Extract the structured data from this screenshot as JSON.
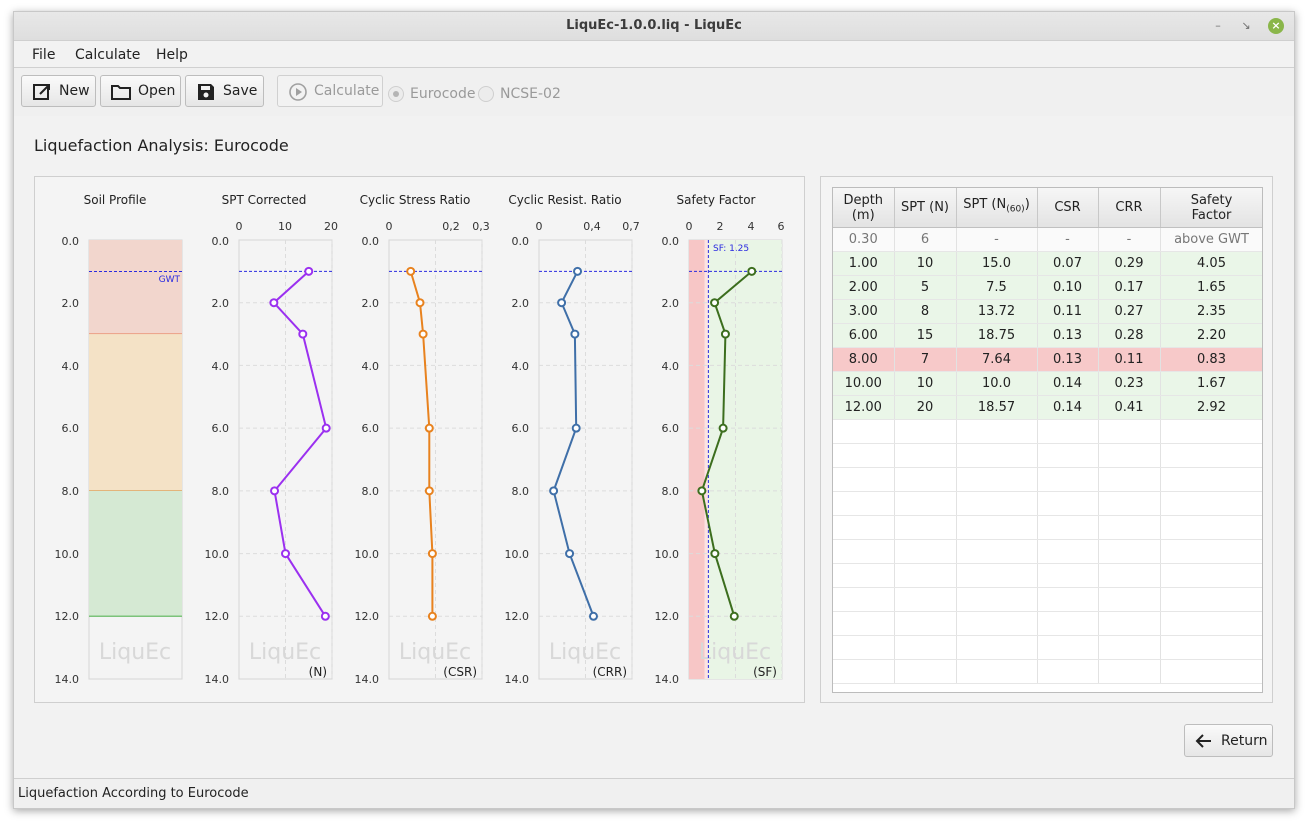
{
  "window": {
    "title": "LiquEc-1.0.0.liq - LiquEc"
  },
  "menu": [
    "File",
    "Calculate",
    "Help"
  ],
  "toolbar": {
    "new_label": "New",
    "open_label": "Open",
    "save_label": "Save",
    "calculate_label": "Calculate",
    "eurocode_label": "Eurocode",
    "ncse_label": "NCSE-02",
    "selected_code": "Eurocode"
  },
  "page": {
    "title": "Liquefaction Analysis: Eurocode"
  },
  "charts": {
    "watermark": "LiquEc",
    "gwt_label": "GWT",
    "sf_line_label": "SF: 1.25",
    "depth_ticks": [
      "0.0",
      "2.0",
      "4.0",
      "6.0",
      "8.0",
      "10.0",
      "12.0",
      "14.0"
    ],
    "titles": [
      "Soil Profile",
      "SPT Corrected",
      "Cyclic Stress Ratio",
      "Cyclic Resist. Ratio",
      "Safety Factor"
    ],
    "units": [
      "(N)",
      "(CSR)",
      "(CRR)",
      "(SF)"
    ],
    "x_ticks": [
      [
        "0",
        "10",
        "20"
      ],
      [
        "0",
        "0,2",
        "0,3"
      ],
      [
        "0",
        "0,4",
        "0,7"
      ],
      [
        "0",
        "2",
        "4",
        "6"
      ]
    ]
  },
  "chart_data": [
    {
      "type": "bar",
      "title": "Soil Profile",
      "ylim": [
        0,
        14
      ],
      "layers": [
        {
          "from": 0,
          "to": 3,
          "color": "#f2d6cd",
          "line": "#e8896a"
        },
        {
          "from": 3,
          "to": 8,
          "color": "#f4e2c6",
          "line": "#e3a25c"
        },
        {
          "from": 8,
          "to": 12,
          "color": "#d5e9d3",
          "line": "#7cc37a"
        }
      ],
      "gwt": 1.0
    },
    {
      "type": "line",
      "title": "SPT Corrected",
      "xlabel": "(N)",
      "xlim": [
        0,
        20
      ],
      "ylim": [
        0,
        14
      ],
      "color": "#9b30f0",
      "x": [
        15.0,
        7.5,
        13.72,
        18.75,
        7.64,
        10.0,
        18.57
      ],
      "y": [
        1,
        2,
        3,
        6,
        8,
        10,
        12
      ]
    },
    {
      "type": "line",
      "title": "Cyclic Stress Ratio",
      "xlabel": "(CSR)",
      "xlim": [
        0,
        0.3
      ],
      "ylim": [
        0,
        14
      ],
      "color": "#e8821e",
      "x": [
        0.07,
        0.1,
        0.11,
        0.13,
        0.13,
        0.14,
        0.14
      ],
      "y": [
        1,
        2,
        3,
        6,
        8,
        10,
        12
      ]
    },
    {
      "type": "line",
      "title": "Cyclic Resist. Ratio",
      "xlabel": "(CRR)",
      "xlim": [
        0,
        0.7
      ],
      "ylim": [
        0,
        14
      ],
      "color": "#3f6fa8",
      "x": [
        0.29,
        0.17,
        0.27,
        0.28,
        0.11,
        0.23,
        0.41
      ],
      "y": [
        1,
        2,
        3,
        6,
        8,
        10,
        12
      ]
    },
    {
      "type": "line",
      "title": "Safety Factor",
      "xlabel": "(SF)",
      "xlim": [
        0,
        6
      ],
      "ylim": [
        0,
        14
      ],
      "color": "#3c6e1e",
      "threshold": 1.25,
      "x": [
        4.05,
        1.65,
        2.35,
        2.2,
        0.83,
        1.67,
        2.92
      ],
      "y": [
        1,
        2,
        3,
        6,
        8,
        10,
        12
      ]
    }
  ],
  "table": {
    "headers": [
      "Depth (m)",
      "SPT (N)",
      "SPT (N(60))",
      "CSR",
      "CRR",
      "Safety Factor"
    ],
    "rows": [
      [
        "0.30",
        "6",
        "-",
        "-",
        "-",
        "above GWT"
      ],
      [
        "1.00",
        "10",
        "15.0",
        "0.07",
        "0.29",
        "4.05"
      ],
      [
        "2.00",
        "5",
        "7.5",
        "0.10",
        "0.17",
        "1.65"
      ],
      [
        "3.00",
        "8",
        "13.72",
        "0.11",
        "0.27",
        "2.35"
      ],
      [
        "6.00",
        "15",
        "18.75",
        "0.13",
        "0.28",
        "2.20"
      ],
      [
        "8.00",
        "7",
        "7.64",
        "0.13",
        "0.11",
        "0.83"
      ],
      [
        "10.00",
        "10",
        "10.0",
        "0.14",
        "0.23",
        "1.67"
      ],
      [
        "12.00",
        "20",
        "18.57",
        "0.14",
        "0.41",
        "2.92"
      ]
    ],
    "row_states": [
      "gray",
      "ok",
      "ok",
      "ok",
      "ok",
      "fail",
      "ok",
      "ok"
    ]
  },
  "return_label": "Return",
  "status": "Liquefaction According to Eurocode"
}
